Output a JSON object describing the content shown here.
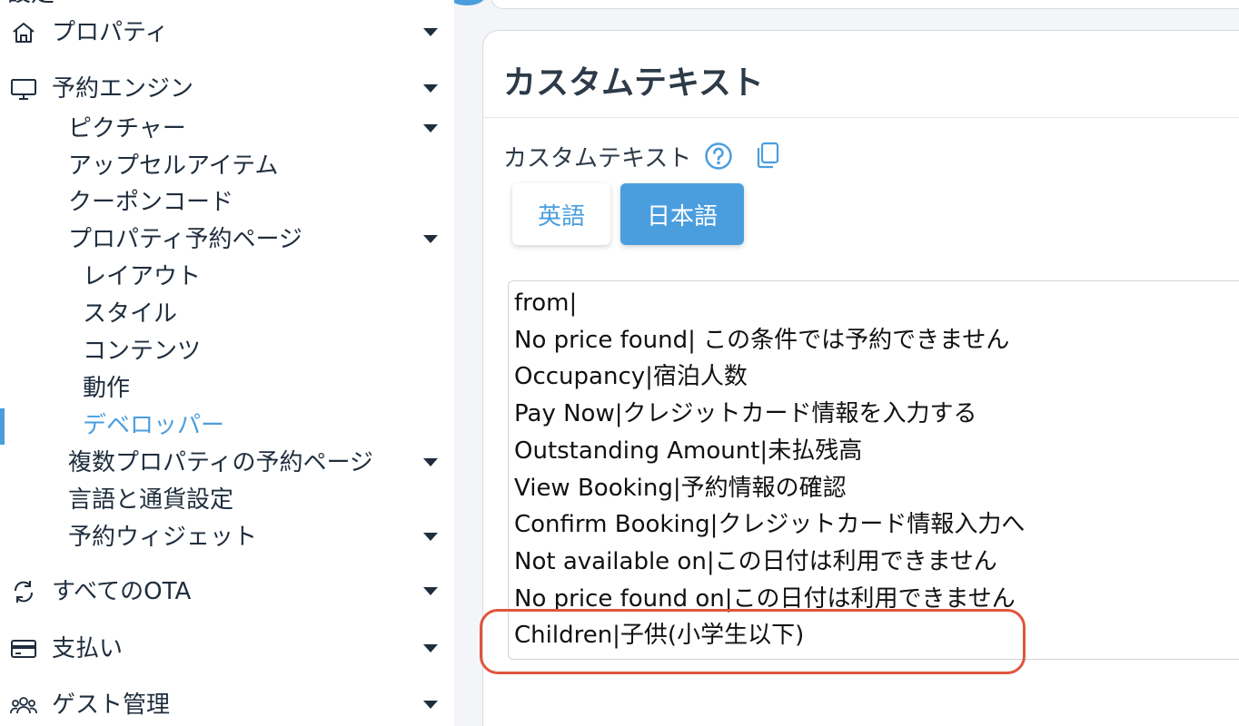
{
  "sidebar": {
    "clipped_label": "設定",
    "items": [
      {
        "label": "プロパティ"
      },
      {
        "label": "予約エンジン"
      },
      {
        "label": "ピクチャー"
      },
      {
        "label": "アップセルアイテム"
      },
      {
        "label": "クーポンコード"
      },
      {
        "label": "プロパティ予約ページ"
      },
      {
        "label": "レイアウト"
      },
      {
        "label": "スタイル"
      },
      {
        "label": "コンテンツ"
      },
      {
        "label": "動作"
      },
      {
        "label": "デベロッパー"
      },
      {
        "label": "複数プロパティの予約ページ"
      },
      {
        "label": "言語と通貨設定"
      },
      {
        "label": "予約ウィジェット"
      },
      {
        "label": "すべてのOTA"
      },
      {
        "label": "支払い"
      },
      {
        "label": "ゲスト管理"
      }
    ]
  },
  "card": {
    "title": "カスタムテキスト",
    "field_label": "カスタムテキスト",
    "lang_buttons": {
      "english": "英語",
      "japanese": "日本語"
    },
    "selected_language": "日本語",
    "lines": [
      "from|",
      "No price found| この条件では予約できません",
      "Occupancy|宿泊人数",
      "Pay Now|クレジットカード情報を入力する",
      "Outstanding Amount|未払残高",
      "View Booking|予約情報の確認",
      "Confirm Booking|クレジットカード情報入力へ",
      "Not available on|この日付は利用できません",
      "No price found on|この日付は利用できません",
      "Children|子供(小学生以下)"
    ]
  },
  "icons": {
    "help": "question-circle-icon",
    "copy": "copy-icon",
    "home": "home-icon",
    "monitor": "monitor-icon",
    "sync": "sync-icon",
    "card": "credit-card-icon",
    "guests": "users-icon",
    "caret": "caret-down-icon"
  },
  "colors": {
    "accent": "#4a9ede",
    "highlight": "#e0553c",
    "text": "#1f2d3d"
  }
}
